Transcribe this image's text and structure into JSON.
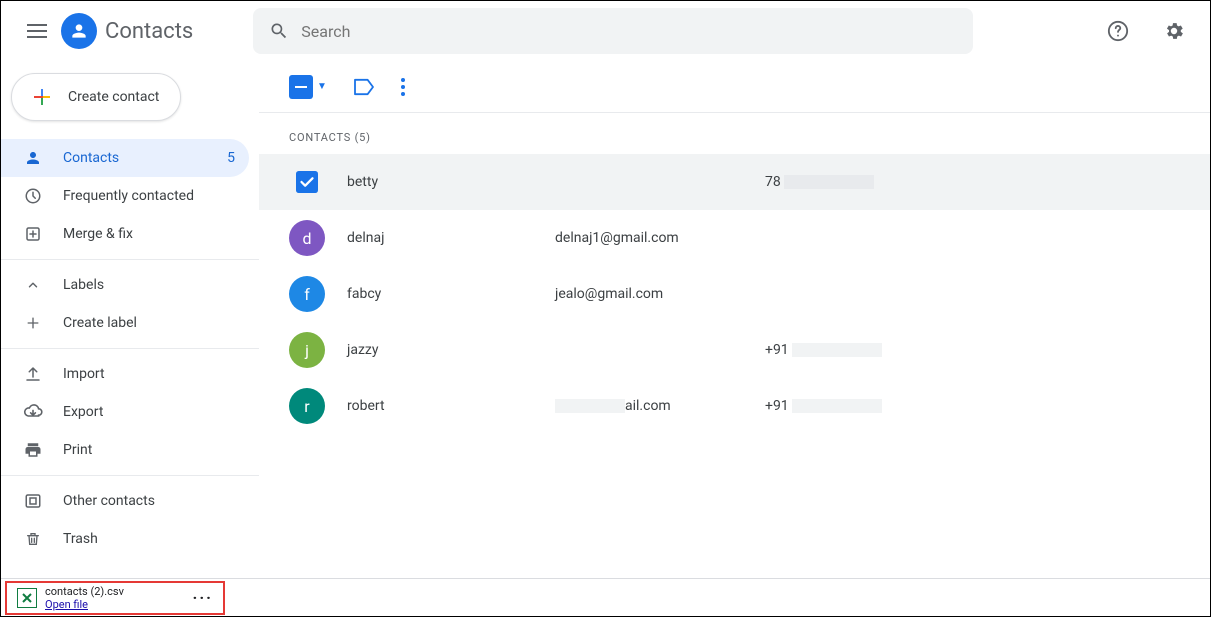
{
  "app": {
    "title": "Contacts"
  },
  "search": {
    "placeholder": "Search"
  },
  "create": {
    "label": "Create contact"
  },
  "sidebar": {
    "contacts": {
      "label": "Contacts",
      "count": "5"
    },
    "frequent": {
      "label": "Frequently contacted"
    },
    "merge": {
      "label": "Merge & fix"
    },
    "labels": {
      "label": "Labels"
    },
    "create_label": {
      "label": "Create label"
    },
    "import": {
      "label": "Import"
    },
    "export": {
      "label": "Export"
    },
    "print": {
      "label": "Print"
    },
    "other": {
      "label": "Other contacts"
    },
    "trash": {
      "label": "Trash"
    }
  },
  "list": {
    "header": "CONTACTS (5)",
    "rows": [
      {
        "name": "betty",
        "email": "",
        "phone_prefix": "78",
        "selected": true,
        "initial": "b",
        "color": "#1a73e8",
        "mask_email": false,
        "mask_phone": true
      },
      {
        "name": "delnaj",
        "email": "delnaj1@gmail.com",
        "phone_prefix": "",
        "selected": false,
        "initial": "d",
        "color": "#7e57c2",
        "mask_email": false,
        "mask_phone": false
      },
      {
        "name": "fabcy",
        "email": "jealo@gmail.com",
        "phone_prefix": "",
        "selected": false,
        "initial": "f",
        "color": "#1e88e5",
        "mask_email": false,
        "mask_phone": false
      },
      {
        "name": "jazzy",
        "email": "",
        "phone_prefix": "+91",
        "selected": false,
        "initial": "j",
        "color": "#7cb342",
        "mask_email": false,
        "mask_phone": true
      },
      {
        "name": "robert",
        "email": "ail.com",
        "phone_prefix": "+91",
        "selected": false,
        "initial": "r",
        "color": "#00897b",
        "mask_email": true,
        "mask_phone": true
      }
    ]
  },
  "download": {
    "filename": "contacts (2).csv",
    "action": "Open file"
  }
}
